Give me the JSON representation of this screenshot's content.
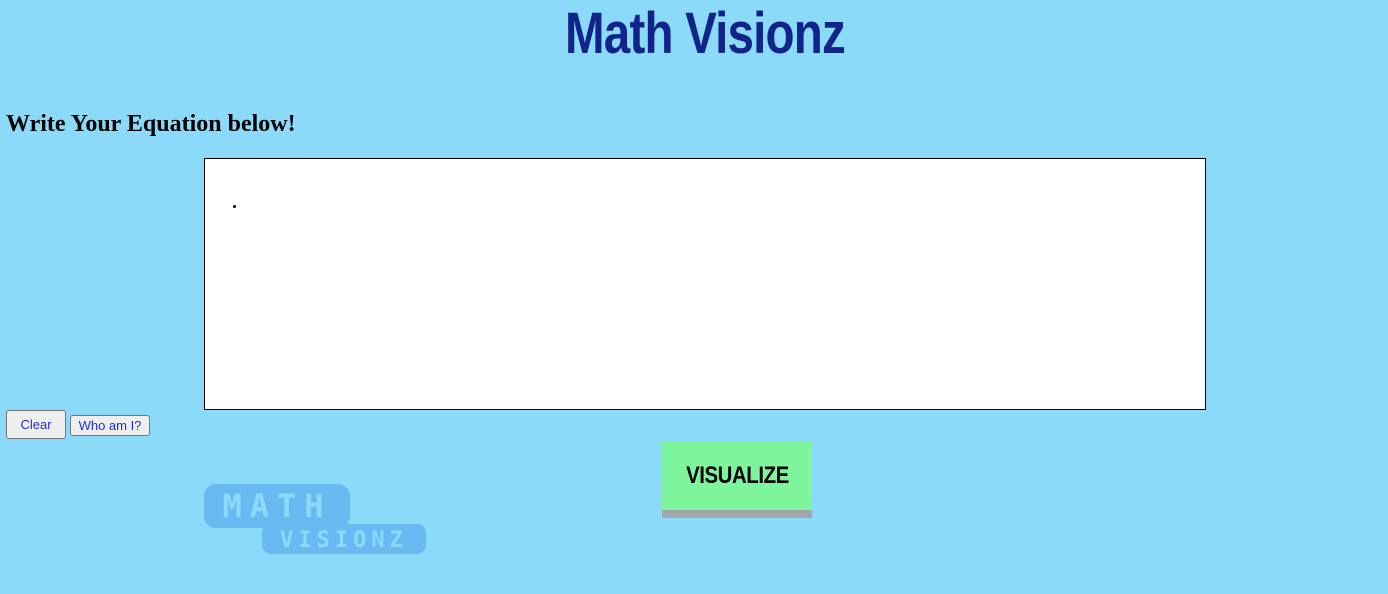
{
  "app": {
    "title": "Math Visionz"
  },
  "instruction": {
    "text": "Write Your Equation below!"
  },
  "buttons": {
    "clear_label": "Clear",
    "who_label": "Who am I?",
    "visualize_label": "VISUALIZE"
  },
  "logo": {
    "line1": "MATH",
    "line2": "VISIONZ",
    "color": "#6ab9f2"
  },
  "colors": {
    "background": "#8bdafa",
    "title": "#10248a",
    "visualize_button": "#7ef59d",
    "link_text": "#1d2fd6"
  }
}
